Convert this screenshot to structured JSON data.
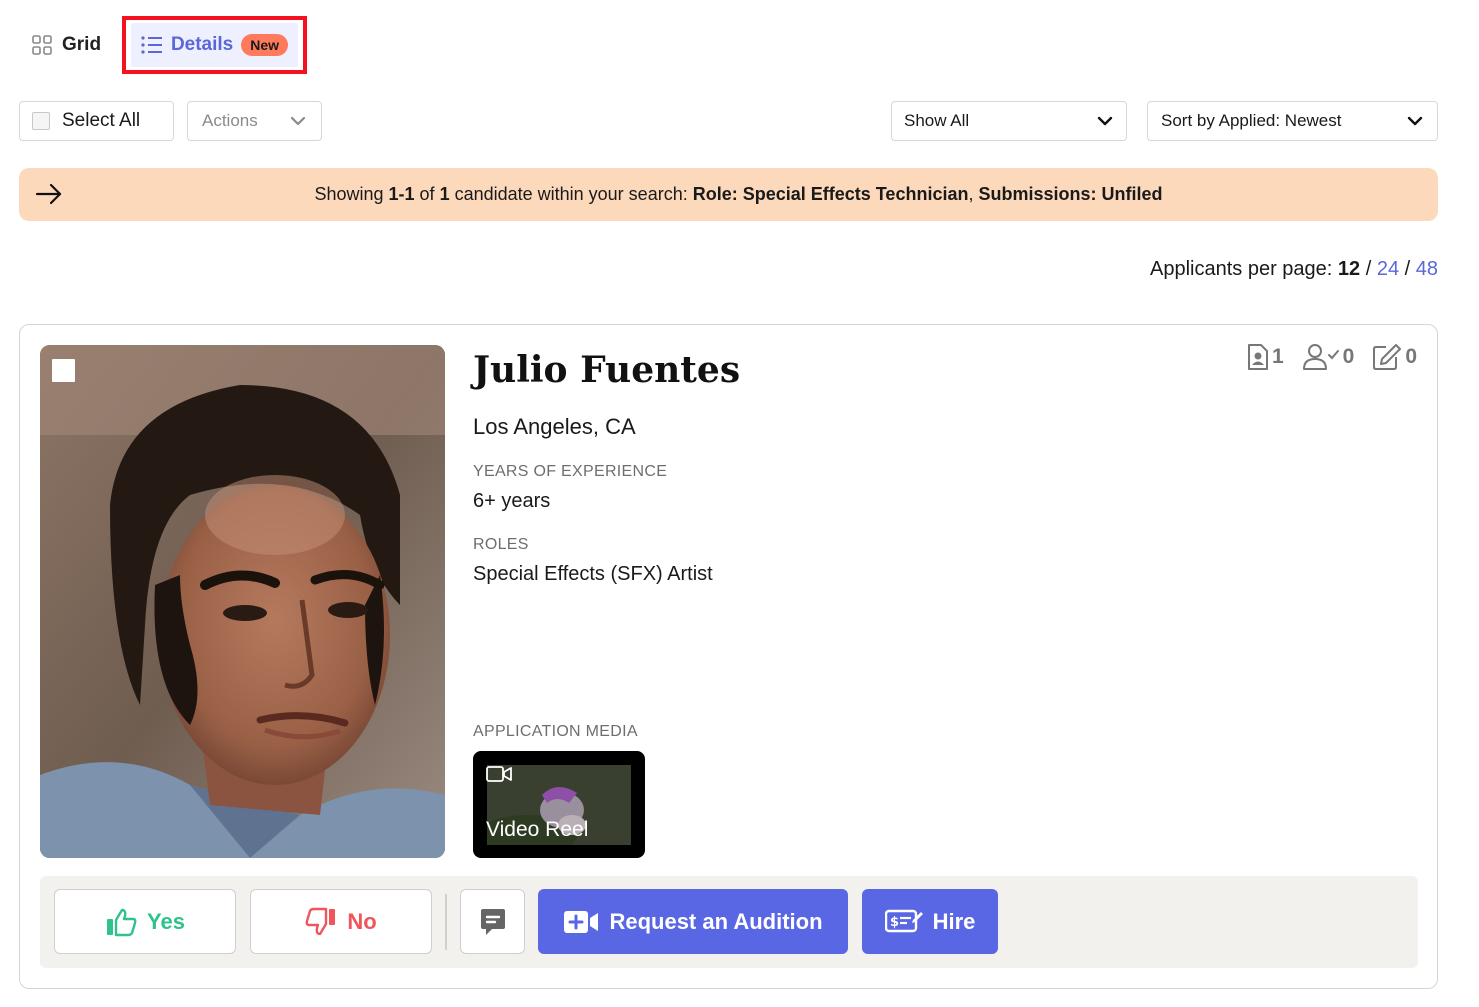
{
  "view_toggle": {
    "grid_label": "Grid",
    "details_label": "Details",
    "details_badge": "New"
  },
  "toolbar": {
    "select_all_label": "Select All",
    "actions_label": "Actions",
    "filter_value": "Show All",
    "sort_prefix": "Sort by ",
    "sort_value": "Applied: Newest"
  },
  "banner": {
    "prefix": "Showing ",
    "range": "1-1",
    "of": " of ",
    "count": "1",
    "suffix": " candidate within your search:  ",
    "role_label": "Role: Special Effects Technician",
    "sep": ",  ",
    "submissions_label": "Submissions: Unfiled"
  },
  "per_page": {
    "label": "Applicants per page: ",
    "options": [
      "12",
      "24",
      "48"
    ],
    "separator": " / "
  },
  "candidate": {
    "name": "Julio Fuentes",
    "location": "Los Angeles, CA",
    "experience_label": "YEARS OF EXPERIENCE",
    "experience_value": "6+ years",
    "roles_label": "ROLES",
    "roles_value": "Special Effects (SFX) Artist",
    "media_label": "APPLICATION MEDIA",
    "media_tile_label": "Video Reel",
    "stats": {
      "resumes": "1",
      "references": "0",
      "notes": "0"
    }
  },
  "actions": {
    "yes_label": "Yes",
    "no_label": "No",
    "audition_label": "Request an Audition",
    "hire_label": "Hire"
  },
  "colors": {
    "accent": "#5a67e4",
    "banner_bg": "#fdd9bb",
    "yes": "#2fc28a",
    "no": "#f0555c",
    "badge": "#ff7a5c",
    "highlight_border": "#f3121e"
  }
}
